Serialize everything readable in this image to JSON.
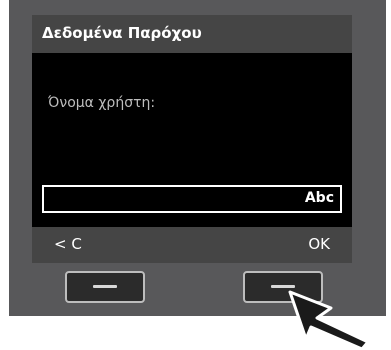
{
  "screen": {
    "title": "Δεδομένα Παρόχου",
    "field_label": "Όνομα χρήστη:",
    "input_value": "",
    "input_mode": "Abc"
  },
  "softkeys": {
    "left_label": "< C",
    "right_label": "OK"
  },
  "indicator": {
    "icon": "pointer-arrow-icon",
    "target": "right-softkey"
  },
  "colors": {
    "bezel": "#58585a",
    "screen": "#000000",
    "bar": "#454545",
    "text": "#ffffff",
    "label": "#bdbdbd"
  }
}
